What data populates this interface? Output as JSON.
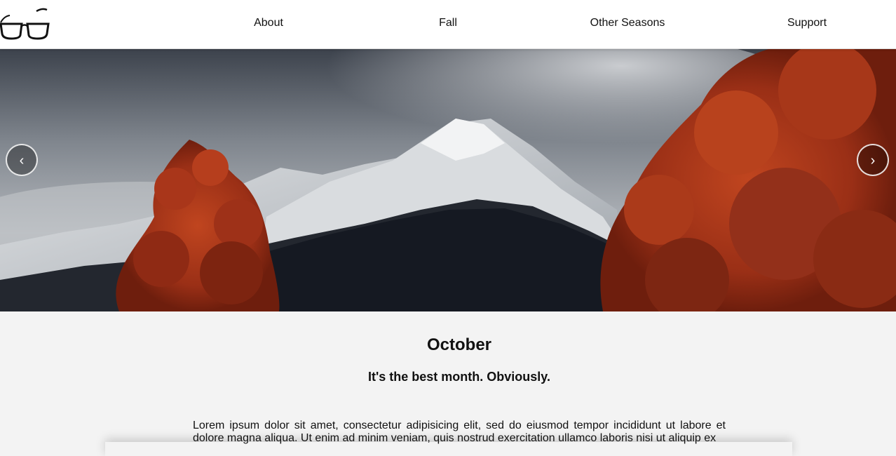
{
  "nav": {
    "logo_icon": "glasses-icon",
    "links": [
      {
        "label": "About"
      },
      {
        "label": "Fall"
      },
      {
        "label": "Other Seasons"
      },
      {
        "label": "Support"
      }
    ]
  },
  "hero": {
    "image": "snowy-mountain-autumn-trees",
    "prev_icon": "chevron-left-icon",
    "prev_glyph": "‹",
    "next_icon": "chevron-right-icon",
    "next_glyph": "›"
  },
  "content": {
    "title": "October",
    "subtitle": "It's the best month. Obviously.",
    "paragraph": "Lorem ipsum dolor sit amet, consectetur adipisicing elit, sed do eiusmod tempor incididunt ut labore et dolore magna aliqua. Ut enim ad minim veniam, quis nostrud exercitation ullamco laboris nisi ut aliquip ex"
  },
  "colors": {
    "nav_bg": "#ffffff",
    "page_bg": "#f3f3f3",
    "foliage": "#a8321a",
    "sky": "#8e949c"
  }
}
